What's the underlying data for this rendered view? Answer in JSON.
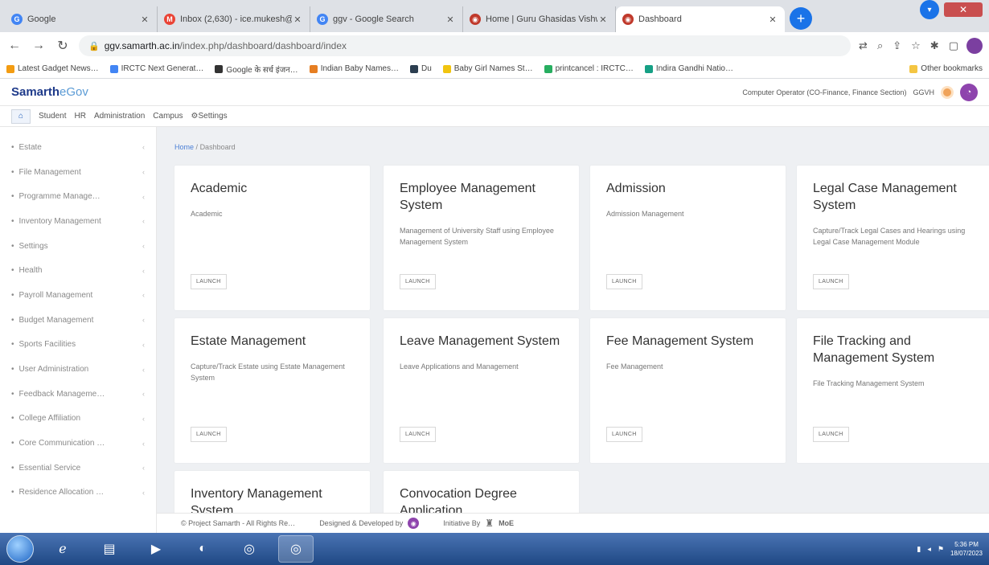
{
  "browser": {
    "tabs": [
      {
        "title": "Google",
        "fav_letter": "G",
        "fav_color": "#4285f4",
        "active": false
      },
      {
        "title": "Inbox (2,630) - ice.mukesh@…",
        "fav_letter": "M",
        "fav_color": "#ea4335",
        "active": false
      },
      {
        "title": "ggv - Google Search",
        "fav_letter": "G",
        "fav_color": "#4285f4",
        "active": false
      },
      {
        "title": "Home | Guru Ghasidas Vishw…",
        "fav_letter": "◉",
        "fav_color": "#c0392b",
        "active": false
      },
      {
        "title": "Dashboard",
        "fav_letter": "◉",
        "fav_color": "#c0392b",
        "active": true
      }
    ],
    "url_host": "ggv.samarth.ac.in",
    "url_path": "/index.php/dashboard/dashboard/index",
    "bookmarks": [
      {
        "label": "Latest Gadget News…",
        "color": "#f39c12"
      },
      {
        "label": "IRCTC Next Generat…",
        "color": "#4285f4"
      },
      {
        "label": "Google के सर्च इंजन…",
        "color": "#333333"
      },
      {
        "label": "Indian Baby Names…",
        "color": "#e67e22"
      },
      {
        "label": "Du",
        "color": "#2c3e50"
      },
      {
        "label": "Baby Girl Names St…",
        "color": "#f1c40f"
      },
      {
        "label": "printcancel : IRCTC…",
        "color": "#27ae60"
      },
      {
        "label": "Indira Gandhi Natio…",
        "color": "#16a085"
      }
    ],
    "other_bookmarks": "Other bookmarks"
  },
  "app": {
    "brand_main": "Samarth",
    "brand_sub": "eGov",
    "user_role": "Computer Operator (CO-Finance, Finance Section)",
    "user_org": "GGVH",
    "menu": [
      "Student",
      "HR",
      "Administration",
      "Campus",
      "⚙Settings"
    ]
  },
  "sidebar": {
    "items": [
      "Estate",
      "File Management",
      "Programme Manage…",
      "Inventory Management",
      "Settings",
      "Health",
      "Payroll Management",
      "Budget Management",
      "Sports Facilities",
      "User Administration",
      "Feedback Manageme…",
      "College Affiliation",
      "Core Communication …",
      "Essential Service",
      "Residence Allocation …"
    ]
  },
  "breadcrumb": {
    "home": "Home",
    "separator": "/",
    "current": "Dashboard"
  },
  "cards": [
    {
      "title": "Academic",
      "desc": "Academic",
      "launch": "LAUNCH"
    },
    {
      "title": "Employee Management System",
      "desc": "Management of University Staff using Employee Management System",
      "launch": "LAUNCH"
    },
    {
      "title": "Admission",
      "desc": "Admission Management",
      "launch": "LAUNCH"
    },
    {
      "title": "Legal Case Management System",
      "desc": "Capture/Track Legal Cases and Hearings using Legal Case Management Module",
      "launch": "LAUNCH"
    },
    {
      "title": "Estate Management",
      "desc": "Capture/Track Estate using Estate Management System",
      "launch": "LAUNCH"
    },
    {
      "title": "Leave Management System",
      "desc": "Leave Applications and Management",
      "launch": "LAUNCH"
    },
    {
      "title": "Fee Management System",
      "desc": "Fee Management",
      "launch": "LAUNCH"
    },
    {
      "title": "File Tracking and Management System",
      "desc": "File Tracking Management System",
      "launch": "LAUNCH"
    },
    {
      "title": "Inventory Management System",
      "desc": "",
      "launch": ""
    },
    {
      "title": "Convocation Degree Application",
      "desc": "",
      "launch": ""
    }
  ],
  "footer": {
    "copyright": "© Project Samarth - All Rights Re…",
    "designed": "Designed & Developed by",
    "initiative": "Initiative By",
    "moe": "MoE"
  },
  "taskbar": {
    "time": "5:36 PM",
    "date": "18/07/2023"
  }
}
